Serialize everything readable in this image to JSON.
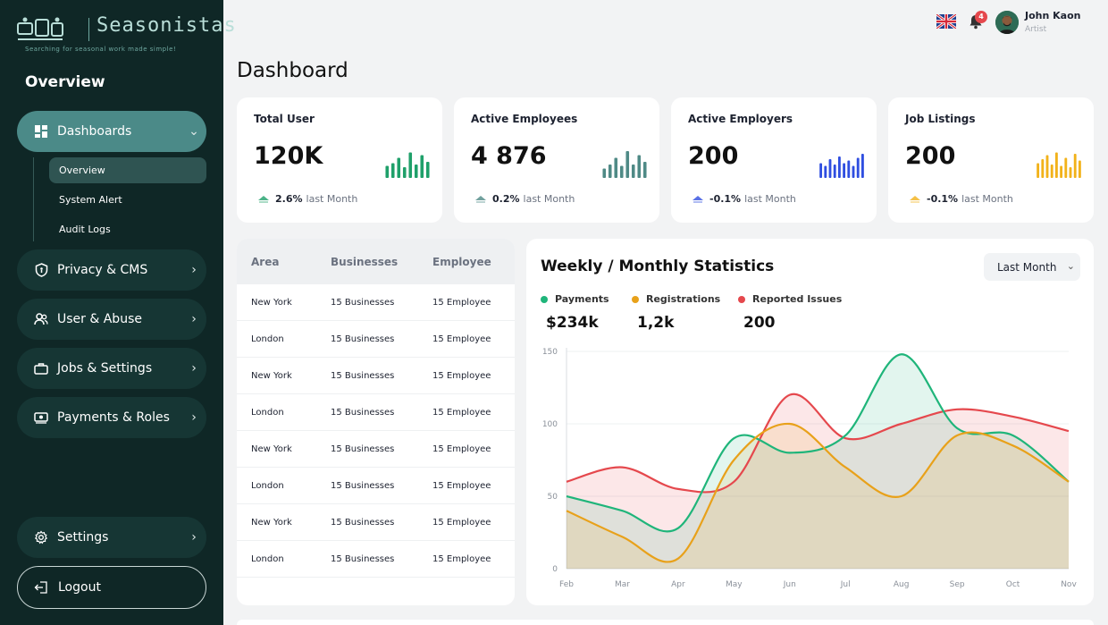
{
  "brand": {
    "name": "Seasonistas",
    "tagline": "Searching for seasonal work made simple!"
  },
  "sidebar": {
    "heading": "Overview",
    "items": [
      {
        "label": "Dashboards",
        "icon": "dashboard-icon",
        "active": true
      },
      {
        "label": "Privacy & CMS",
        "icon": "shield-icon"
      },
      {
        "label": "User & Abuse",
        "icon": "users-icon"
      },
      {
        "label": "Jobs & Settings",
        "icon": "briefcase-icon"
      },
      {
        "label": "Payments & Roles",
        "icon": "payment-icon"
      }
    ],
    "subitems": [
      "Overview",
      "System Alert",
      "Audit Logs"
    ],
    "settings_label": "Settings",
    "logout_label": "Logout"
  },
  "topbar": {
    "notification_count": "4",
    "user_name": "John Kaon",
    "user_role": "Artist"
  },
  "page": {
    "title": "Dashboard"
  },
  "stats": [
    {
      "label": "Total User",
      "value": "120K",
      "change": "2.6%",
      "suffix": "last Month",
      "color": "#1fa06a",
      "bars": [
        0.45,
        0.55,
        0.75,
        0.4,
        0.95,
        0.5,
        0.85,
        0.6
      ]
    },
    {
      "label": "Active Employees",
      "value": "4 876",
      "change": "0.2%",
      "suffix": "last Month",
      "color": "#4f8a86",
      "bars": [
        0.35,
        0.5,
        0.75,
        0.45,
        1.0,
        0.5,
        0.85,
        0.6
      ]
    },
    {
      "label": "Active Employers",
      "value": "200",
      "change": "-0.1%",
      "suffix": "last Month",
      "color": "#2f4ee0",
      "bars": [
        0.55,
        0.45,
        0.7,
        0.5,
        0.8,
        0.55,
        0.65,
        0.45,
        0.75,
        0.9
      ]
    },
    {
      "label": "Job Listings",
      "value": "200",
      "change": "-0.1%",
      "suffix": "last Month",
      "color": "#f2b21a",
      "bars": [
        0.55,
        0.7,
        0.85,
        0.5,
        0.95,
        0.45,
        0.75,
        0.4,
        0.9,
        0.65
      ]
    }
  ],
  "table": {
    "headers": [
      "Area",
      "Businesses",
      "Employee"
    ],
    "rows": [
      [
        "New York",
        "15 Businesses",
        "15 Employee"
      ],
      [
        "London",
        "15 Businesses",
        "15 Employee"
      ],
      [
        "New York",
        "15 Businesses",
        "15 Employee"
      ],
      [
        "London",
        "15 Businesses",
        "15 Employee"
      ],
      [
        "New York",
        "15 Businesses",
        "15 Employee"
      ],
      [
        "London",
        "15 Businesses",
        "15 Employee"
      ],
      [
        "New York",
        "15 Businesses",
        "15 Employee"
      ],
      [
        "London",
        "15 Businesses",
        "15 Employee"
      ]
    ]
  },
  "chart_panel": {
    "title": "Weekly / Monthly Statistics",
    "dropdown": "Last Month",
    "legend": [
      {
        "name": "Payments",
        "value": "$234k",
        "color": "#1fb57a"
      },
      {
        "name": "Registrations",
        "value": "1,2k",
        "color": "#e8a11a"
      },
      {
        "name": "Reported Issues",
        "value": "200",
        "color": "#e5484d"
      }
    ]
  },
  "chart_data": {
    "type": "area",
    "x": [
      "Feb",
      "Mar",
      "Apr",
      "May",
      "Jun",
      "Jul",
      "Aug",
      "Sep",
      "Oct",
      "Nov"
    ],
    "yticks": [
      0,
      50,
      100,
      150
    ],
    "ylim": [
      0,
      150
    ],
    "grid": true,
    "series": [
      {
        "name": "Payments",
        "values": [
          50,
          40,
          28,
          90,
          80,
          92,
          148,
          97,
          92,
          60
        ]
      },
      {
        "name": "Registrations",
        "values": [
          40,
          22,
          7,
          75,
          100,
          70,
          50,
          92,
          85,
          60
        ]
      },
      {
        "name": "Reported Issues",
        "values": [
          60,
          70,
          55,
          60,
          120,
          90,
          100,
          110,
          105,
          95
        ]
      }
    ]
  }
}
